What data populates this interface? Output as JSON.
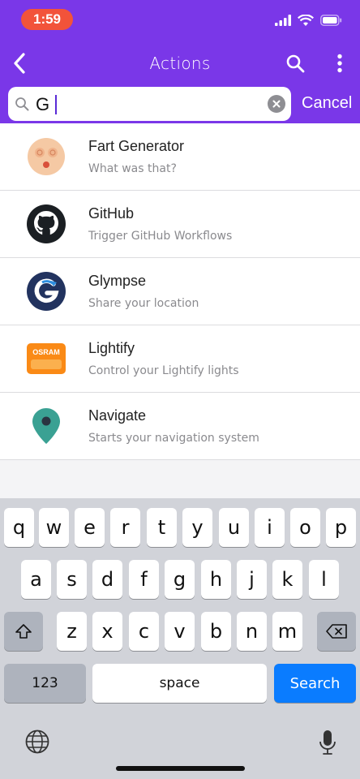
{
  "status": {
    "time": "1:59"
  },
  "nav": {
    "title": "Actions"
  },
  "search": {
    "value": "G",
    "cancel_label": "Cancel"
  },
  "items": [
    {
      "title": "Fart Generator",
      "subtitle": "What was that?",
      "icon": "fart-face-icon"
    },
    {
      "title": "GitHub",
      "subtitle": "Trigger GitHub Workflows",
      "icon": "github-icon"
    },
    {
      "title": "Glympse",
      "subtitle": "Share your location",
      "icon": "glympse-icon"
    },
    {
      "title": "Lightify",
      "subtitle": "Control your Lightify lights",
      "icon": "lightify-icon",
      "brand_text": "OSRAM"
    },
    {
      "title": "Navigate",
      "subtitle": "Starts your navigation system",
      "icon": "map-pin-icon"
    }
  ],
  "keyboard": {
    "row1": [
      "q",
      "w",
      "e",
      "r",
      "t",
      "y",
      "u",
      "i",
      "o",
      "p"
    ],
    "row2": [
      "a",
      "s",
      "d",
      "f",
      "g",
      "h",
      "j",
      "k",
      "l"
    ],
    "row3": [
      "z",
      "x",
      "c",
      "v",
      "b",
      "n",
      "m"
    ],
    "numbers_label": "123",
    "space_label": "space",
    "return_label": "Search"
  },
  "colors": {
    "header": "#7a37e8",
    "time_pill": "#f2533a",
    "search_key": "#0a7cff"
  }
}
